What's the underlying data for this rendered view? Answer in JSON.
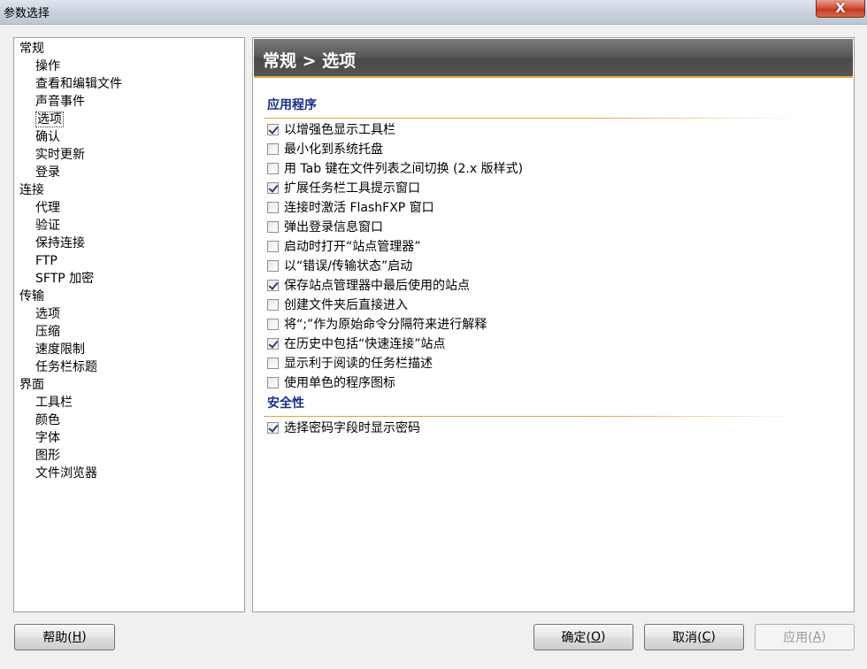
{
  "window": {
    "title": "参数选择",
    "close_label": "X"
  },
  "tree": {
    "groups": [
      {
        "label": "常规",
        "children": [
          "操作",
          "查看和编辑文件",
          "声音事件",
          "选项",
          "确认",
          "实时更新",
          "登录"
        ]
      },
      {
        "label": "连接",
        "children": [
          "代理",
          "验证",
          "保持连接",
          "FTP",
          "SFTP 加密"
        ]
      },
      {
        "label": "传输",
        "children": [
          "选项",
          "压缩",
          "速度限制",
          "任务栏标题"
        ]
      },
      {
        "label": "界面",
        "children": [
          "工具栏",
          "颜色",
          "字体",
          "图形",
          "文件浏览器"
        ]
      }
    ],
    "selected": "常规.选项"
  },
  "content": {
    "header": "常规 > 选项",
    "sections": [
      {
        "title": "应用程序",
        "options": [
          {
            "label": "以增强色显示工具栏",
            "checked": true
          },
          {
            "label": "最小化到系统托盘",
            "checked": false
          },
          {
            "label": "用 Tab 键在文件列表之间切换 (2.x 版样式)",
            "checked": false
          },
          {
            "label": "扩展任务栏工具提示窗口",
            "checked": true
          },
          {
            "label": "连接时激活 FlashFXP 窗口",
            "checked": false
          },
          {
            "label": "弹出登录信息窗口",
            "checked": false
          },
          {
            "label": "启动时打开“站点管理器”",
            "checked": false
          },
          {
            "label": "以“错误/传输状态”启动",
            "checked": false
          },
          {
            "label": "保存站点管理器中最后使用的站点",
            "checked": true
          },
          {
            "label": "创建文件夹后直接进入",
            "checked": false
          },
          {
            "label": "将“;”作为原始命令分隔符来进行解释",
            "checked": false
          },
          {
            "label": "在历史中包括“快速连接”站点",
            "checked": true
          },
          {
            "label": "显示利于阅读的任务栏描述",
            "checked": false
          },
          {
            "label": "使用单色的程序图标",
            "checked": false
          }
        ]
      },
      {
        "title": "安全性",
        "options": [
          {
            "label": "选择密码字段时显示密码",
            "checked": true
          }
        ]
      }
    ]
  },
  "buttons": {
    "help": {
      "label": "帮助(",
      "accel": "H",
      "suffix": ")"
    },
    "ok": {
      "label": "确定(",
      "accel": "O",
      "suffix": ")"
    },
    "cancel": {
      "label": "取消(",
      "accel": "C",
      "suffix": ")"
    },
    "apply": {
      "label": "应用(",
      "accel": "A",
      "suffix": ")",
      "disabled": true
    }
  }
}
